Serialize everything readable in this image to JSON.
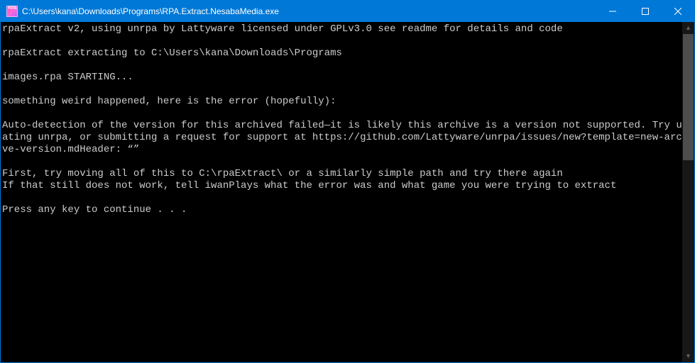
{
  "window": {
    "title": "C:\\Users\\kana\\Downloads\\Programs\\RPA.Extract.NesabaMedia.exe"
  },
  "console": {
    "lines": [
      "rpaExtract v2, using unrpa by Lattyware licensed under GPLv3.0 see readme for details and code",
      "",
      "rpaExtract extracting to C:\\Users\\kana\\Downloads\\Programs",
      "",
      "images.rpa STARTING...",
      "",
      "something weird happened, here is the error (hopefully):",
      "",
      "Auto-detection of the version for this archived failed—it is likely this archive is a version not supported. Try updating unrpa, or submitting a request for support at https://github.com/Lattyware/unrpa/issues/new?template=new-archive-version.mdHeader: “”",
      "",
      "First, try moving all of this to C:\\rpaExtract\\ or a similarly simple path and try there again",
      "If that still does not work, tell iwanPlays what the error was and what game you were trying to extract",
      "",
      "Press any key to continue . . ."
    ]
  }
}
